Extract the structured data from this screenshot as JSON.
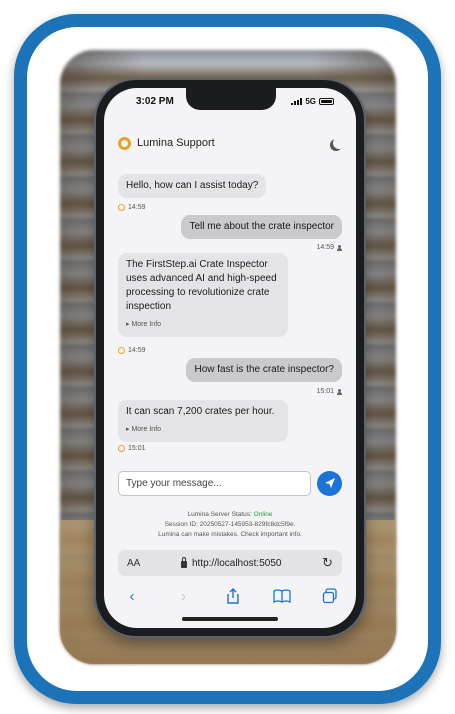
{
  "status_bar": {
    "time": "3:02 PM",
    "network": "5G"
  },
  "app": {
    "title": "Lumina Support"
  },
  "messages": [
    {
      "sender": "bot",
      "text": "Hello, how can I assist today?",
      "time": "14:59"
    },
    {
      "sender": "user",
      "text": "Tell me about the crate inspector",
      "time": "14:59"
    },
    {
      "sender": "bot",
      "text": "The FirstStep.ai Crate Inspector uses advanced AI and high-speed processing to revolutionize crate inspection",
      "more": "▸ More Info",
      "time": "14:59"
    },
    {
      "sender": "user",
      "text": "How fast is the crate inspector?",
      "time": "15:01"
    },
    {
      "sender": "bot",
      "text": "It can scan 7,200 crates per hour.",
      "more": "▸ More Info",
      "time": "15:01"
    }
  ],
  "composer": {
    "placeholder": "Type your message..."
  },
  "footer": {
    "status_label": "Lumina Server Status:",
    "status_value": "Online",
    "session": "Session ID: 20250527-145953-829fc8dc5f9e.",
    "disclaimer": "Lumina can make mistakes. Check important info."
  },
  "browser": {
    "aa_label": "AA",
    "url": "http://localhost:5050"
  },
  "colors": {
    "frame": "#1d73b8",
    "accent": "#1b73d8",
    "logo": "#e8a323",
    "online": "#2a9d34"
  }
}
